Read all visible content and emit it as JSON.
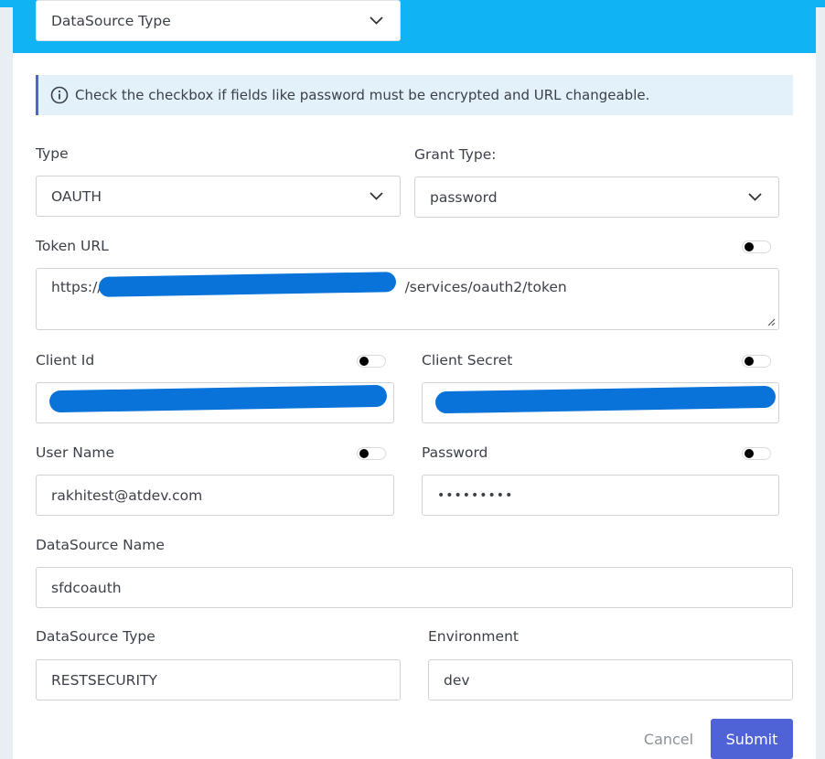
{
  "header": {
    "datasource_type_select": "DataSource Type"
  },
  "info": {
    "message": "Check the checkbox if fields like password must be encrypted and URL changeable."
  },
  "form": {
    "type_label": "Type",
    "type_value": "OAUTH",
    "grant_type_label": "Grant Type:",
    "grant_type_value": "password",
    "token_url_label": "Token URL",
    "token_url_prefix": "https://",
    "token_url_suffix": "/services/oauth2/token",
    "client_id_label": "Client Id",
    "client_secret_label": "Client Secret",
    "user_name_label": "User Name",
    "user_name_value": "rakhitest@atdev.com",
    "password_label": "Password",
    "password_value": "•••••••••",
    "datasource_name_label": "DataSource Name",
    "datasource_name_value": "sfdcoauth",
    "datasource_type_label": "DataSource Type",
    "datasource_type_value": "RESTSECURITY",
    "environment_label": "Environment",
    "environment_value": "dev"
  },
  "actions": {
    "cancel_label": "Cancel",
    "submit_label": "Submit"
  },
  "colors": {
    "header_blue": "#10b4f4",
    "accent": "#4f62d6",
    "info_bg": "#e3f1fb",
    "redaction": "#0a73d9"
  },
  "toggles": {
    "token_url": "off",
    "client_id": "off",
    "client_secret": "off",
    "user_name": "off",
    "password": "off"
  }
}
